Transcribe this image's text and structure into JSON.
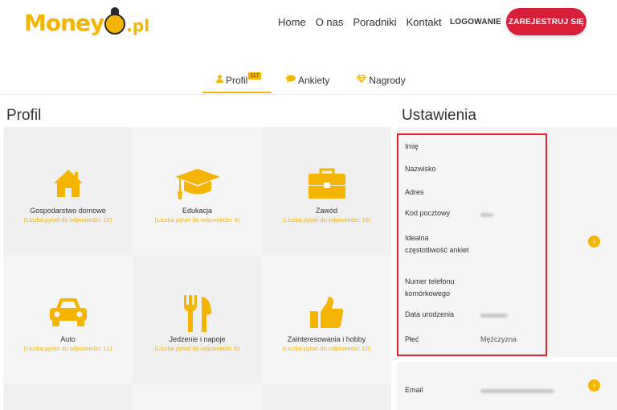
{
  "header": {
    "logo_text": "Money",
    "logo_suffix": ".pl",
    "nav": [
      "Home",
      "O nas",
      "Poradniki",
      "Kontakt"
    ],
    "login_label": "LOGOWANIE",
    "register_label": "ZAREJESTRUJ SIĘ"
  },
  "tabs": [
    {
      "label": "Profil",
      "badge": "117",
      "icon": "user-icon"
    },
    {
      "label": "Ankiety",
      "icon": "speech-bubble-icon"
    },
    {
      "label": "Nagrody",
      "icon": "diamond-icon"
    }
  ],
  "profil": {
    "title": "Profil",
    "categories": [
      {
        "name": "Gospodarstwo domowe",
        "count": "(Liczba pytań do odpowiedzi: 15)",
        "icon": "house-icon"
      },
      {
        "name": "Edukacja",
        "count": "(Liczba pytań do odpowiedzi: 4)",
        "icon": "graduation-cap-icon"
      },
      {
        "name": "Zawód",
        "count": "(Liczba pytań do odpowiedzi: 16)",
        "icon": "briefcase-icon"
      },
      {
        "name": "Auto",
        "count": "(Liczba pytań do odpowiedzi: 12)",
        "icon": "car-icon"
      },
      {
        "name": "Jedzenie i napoje",
        "count": "(Liczba pytań do odpowiedzi: 6)",
        "icon": "cutlery-icon"
      },
      {
        "name": "Zainteresowania i hobby",
        "count": "(Liczba pytań do odpowiedzi: 10)",
        "icon": "thumbs-up-icon"
      }
    ]
  },
  "settings": {
    "title": "Ustawienia",
    "fields": [
      {
        "label": "Imię",
        "value": ""
      },
      {
        "label": "Nazwisko",
        "value": ""
      },
      {
        "label": "Adres",
        "value": ""
      },
      {
        "label": "Kod pocztowy",
        "value": ""
      },
      {
        "label": "Idealna częstotliwość ankiet",
        "value": ""
      },
      {
        "label": "Numer telefonu komórkowego",
        "value": ""
      },
      {
        "label": "Data urodzenia",
        "value": ""
      },
      {
        "label": "Płeć",
        "value": "Mężczyzna"
      }
    ],
    "email_label": "Email"
  },
  "colors": {
    "accent": "#f5b400",
    "register": "#d71f3a",
    "highlight_border": "#e8202f"
  }
}
